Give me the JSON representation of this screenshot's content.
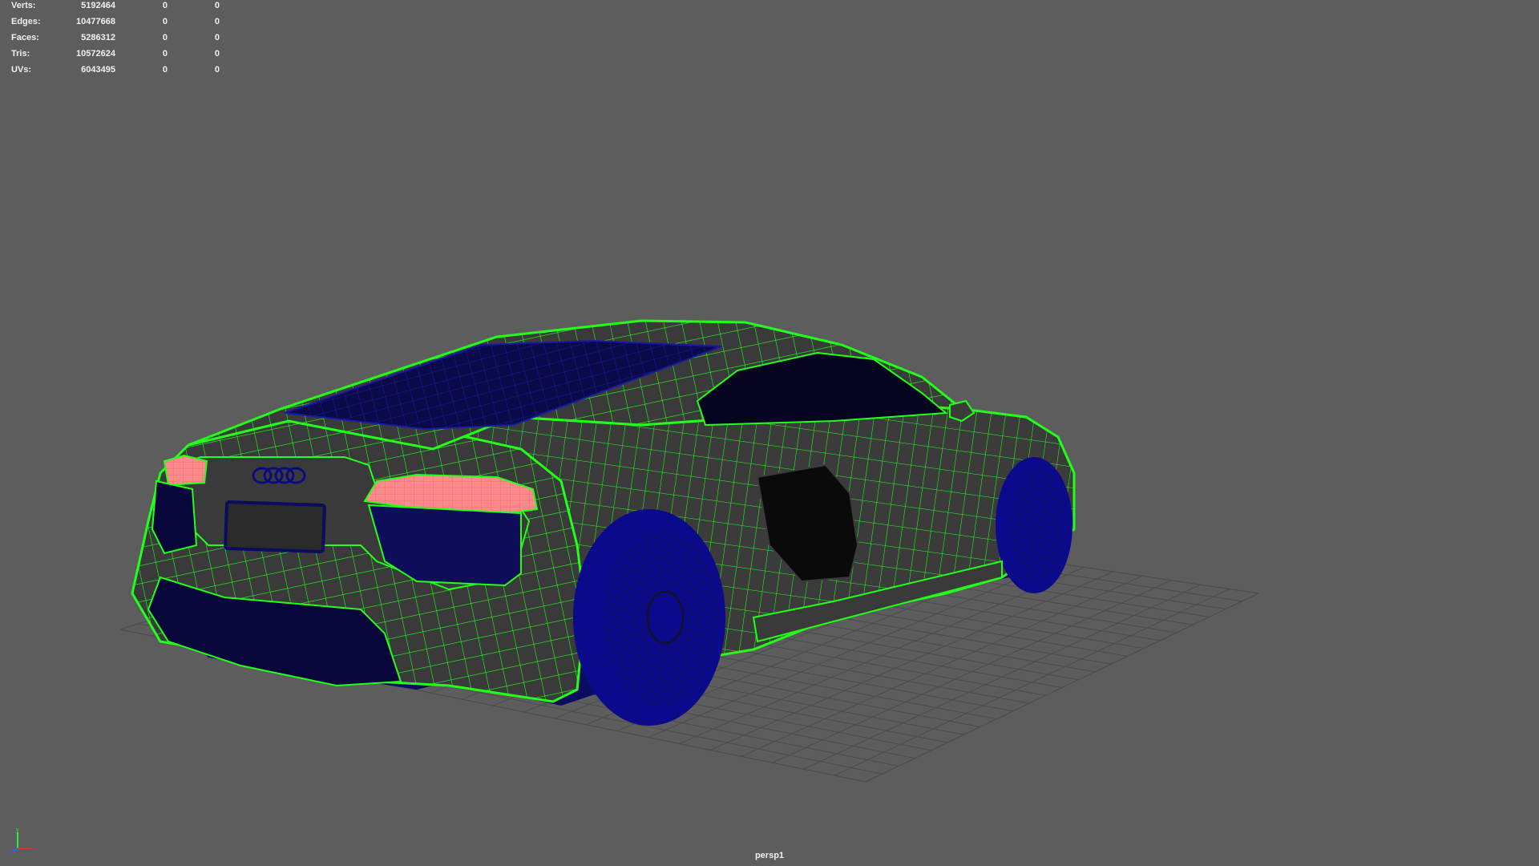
{
  "hud": {
    "rows": [
      {
        "label": "Verts:",
        "total": "5192464",
        "selected": "0",
        "component": "0"
      },
      {
        "label": "Edges:",
        "total": "10477668",
        "selected": "0",
        "component": "0"
      },
      {
        "label": "Faces:",
        "total": "5286312",
        "selected": "0",
        "component": "0"
      },
      {
        "label": "Tris:",
        "total": "10572624",
        "selected": "0",
        "component": "0"
      },
      {
        "label": "UVs:",
        "total": "6043495",
        "selected": "0",
        "component": "0"
      }
    ]
  },
  "viewport": {
    "camera": "persp1",
    "background_color": "#5d5d5d",
    "wireframe_color": "#22ff1a",
    "shaded_color": "#0d0d99",
    "taillight_color": "#ff8080"
  },
  "axis_gizmo": {
    "x_label": "x",
    "y_label": "y",
    "z_label": "z"
  }
}
